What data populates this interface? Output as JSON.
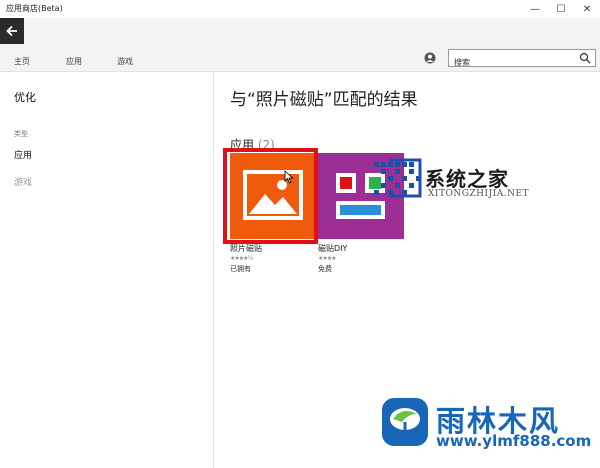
{
  "window": {
    "title": "应用商店(Beta)",
    "minimize": "—",
    "maximize": "☐",
    "close": "✕"
  },
  "navigation": {
    "tabs": [
      "主页",
      "应用",
      "游戏"
    ]
  },
  "search": {
    "value": "搜索"
  },
  "sidebar": {
    "heading": "优化",
    "type_label": "类型",
    "items": [
      {
        "label": "应用",
        "active": true
      },
      {
        "label": "游戏",
        "active": false
      }
    ]
  },
  "results": {
    "title": "与“照片磁贴”匹配的结果",
    "section_label": "应用",
    "section_count": "(2)",
    "apps": [
      {
        "name": "照片磁贴",
        "rating_stars": "★★★★½",
        "price": "已拥有",
        "tile_color": "#ef5a0c"
      },
      {
        "name": "磁贴DIY",
        "rating_stars": "★★★★",
        "price": "免费",
        "tile_color": "#9b2f96"
      }
    ]
  },
  "highlight_color": "#e0101a",
  "watermarks": {
    "top_text": "系统之家",
    "top_url": "XITONGZHIJIA.NET",
    "bottom_text": "雨林木风",
    "bottom_url": "www.ylmf888.com",
    "bottom_color": "#1766b8"
  }
}
